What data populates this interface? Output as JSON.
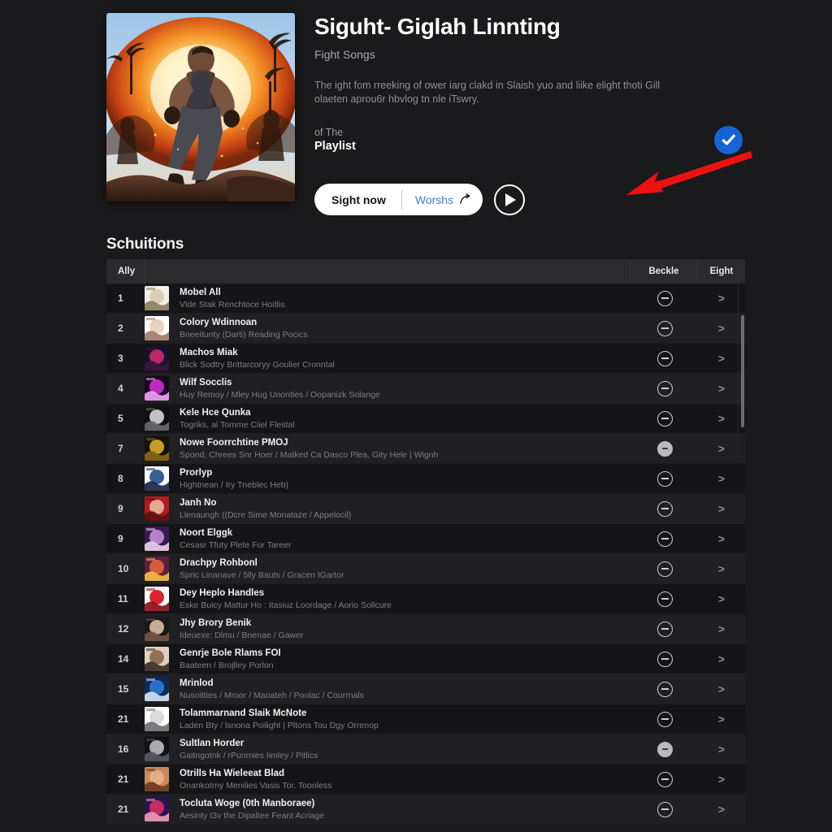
{
  "hero": {
    "title": "Siguht- Giglah Linnting",
    "subtitle": "Fight Songs",
    "description": "The ight fom rreeking of ower iarg clakd in Slaish yuo and liike elight thoti Gill olaeten aprou6r hbvlog tn nle iTswry.",
    "owner_label": "of The",
    "owner_name": "Playlist",
    "verified_icon": "verified-check-icon",
    "cover_icon": "playlist-cover-art"
  },
  "actions": {
    "primary_label": "Sight now",
    "secondary_label": "Worshs",
    "share_icon": "share-arrow-icon",
    "play_icon": "play-icon"
  },
  "annotation": {
    "arrow_icon": "red-pointer-arrow",
    "arrow_color": "#ee1111"
  },
  "section": {
    "title": "Schuitions"
  },
  "table": {
    "headers": {
      "rank": "Ally",
      "middle": "",
      "action": "Beckle",
      "detail": "Eight"
    },
    "chevron": ">",
    "rows": [
      {
        "rank": "1",
        "name": "Mobel All",
        "sub": "Vlde Stak  Renchtoce Hoitlis",
        "action_icon": "remove-circle-icon",
        "action_state": "outline",
        "art": [
          "#f3efe6",
          "#d8cdb6",
          "#8a7b5e"
        ]
      },
      {
        "rank": "2",
        "name": "Colory Wdinnoan",
        "sub": "Bneeitunty (Darti) Reading Pocics",
        "action_icon": "remove-circle-icon",
        "action_state": "outline",
        "art": [
          "#ffffff",
          "#e8cdbb",
          "#9d7b63"
        ]
      },
      {
        "rank": "3",
        "name": "Machos Miak",
        "sub": "Blick Sodtry Brittarcoryy Goulier Cronntal",
        "action_icon": "remove-circle-icon",
        "action_state": "outline",
        "art": [
          "#16122a",
          "#c42a6e",
          "#3b1640"
        ]
      },
      {
        "rank": "4",
        "name": "Wilf Socclis",
        "sub": "Huy Remoy / Mley Hug Unontles / Oopanizk Solange",
        "action_icon": "remove-circle-icon",
        "action_state": "outline",
        "art": [
          "#1a0520",
          "#d22ad0",
          "#f0a8f5"
        ]
      },
      {
        "rank": "5",
        "name": "Kele Hce Qunka",
        "sub": "Togriks, al Tomme Ciiel Flestal",
        "action_icon": "remove-circle-icon",
        "action_state": "outline",
        "art": [
          "#101014",
          "#cfcfd4",
          "#6a6a72"
        ]
      },
      {
        "rank": "7",
        "name": "Nowe Foorrchtine PMOJ",
        "sub": "Spond, Chrees Snr Hoer / Matked Ca Dasco Plea, Gity Hele | Wignh",
        "action_icon": "remove-circle-filled-icon",
        "action_state": "filled",
        "art": [
          "#171206",
          "#d4a92a",
          "#8a6a12"
        ]
      },
      {
        "rank": "8",
        "name": "Prorlyp",
        "sub": "Hightnean / Iry Tneblec Heb)",
        "action_icon": "remove-circle-icon",
        "action_state": "outline",
        "art": [
          "#ffffff",
          "#2a4f8e",
          "#14233f"
        ]
      },
      {
        "rank": "9",
        "name": "Janh No",
        "sub": "Llenaungh  ((Dcre Sime Monataze / Appelocil)",
        "action_icon": "remove-circle-icon",
        "action_state": "outline",
        "art": [
          "#b41a20",
          "#e8b59a",
          "#5e1014"
        ]
      },
      {
        "rank": "9",
        "name": "Noort Elggk",
        "sub": "Cesasr Tfuty Plete For Tareer",
        "action_icon": "remove-circle-icon",
        "action_state": "outline",
        "art": [
          "#3a1a52",
          "#c289d8",
          "#efd3ea"
        ]
      },
      {
        "rank": "10",
        "name": "Drachpy Rohbonl",
        "sub": "Spric Linanave / 5lly Bauts / Gracen IGartor",
        "action_icon": "remove-circle-icon",
        "action_state": "outline",
        "art": [
          "#5e2040",
          "#e0633c",
          "#f2c244"
        ]
      },
      {
        "rank": "11",
        "name": "Dey Heplo Handles",
        "sub": "Eske Buicy Mattur Ho : Itasiuz Loordage / Aorio Sollcure",
        "action_icon": "remove-circle-icon",
        "action_state": "outline",
        "art": [
          "#ffffff",
          "#d8121c",
          "#8a0a12"
        ]
      },
      {
        "rank": "12",
        "name": "Jhy Brory Benik",
        "sub": "Ideuexe: Dlmu / Bnenae / Gawer",
        "action_icon": "remove-circle-icon",
        "action_state": "outline",
        "art": [
          "#18181a",
          "#d8b9a0",
          "#76584a"
        ]
      },
      {
        "rank": "14",
        "name": "Genrje Bole Rlams FOI",
        "sub": "Baateen / Brojlley Porlon",
        "action_icon": "remove-circle-icon",
        "action_state": "outline",
        "art": [
          "#e2cfc0",
          "#8a6a52",
          "#3a2a22"
        ]
      },
      {
        "rank": "15",
        "name": "Mrinlod",
        "sub": "Nusoitties / Mroor / Maoateh / Poolac / Courrnals",
        "action_icon": "remove-circle-icon",
        "action_state": "outline",
        "art": [
          "#0e2a52",
          "#2a7ad4",
          "#d8e6f5"
        ]
      },
      {
        "rank": "21",
        "name": "Tolammarnand Slaik McNote",
        "sub": "Laden Bty / lsnona Poilight | Pltons Tou Dgy Orrenop",
        "action_icon": "remove-circle-icon",
        "action_state": "outline",
        "art": [
          "#ffffff",
          "#d8d8da",
          "#6a6a70"
        ]
      },
      {
        "rank": "16",
        "name": "Sultlan Horder",
        "sub": "Gaitngotnk / rPunmies Iimley / Pitlics",
        "action_icon": "remove-circle-filled-icon",
        "action_state": "filled",
        "art": [
          "#101012",
          "#b8b8bc",
          "#5a5a60"
        ]
      },
      {
        "rank": "21",
        "name": "Otrills Ha Wieleeat Blad",
        "sub": "Onankotrny Menilies Vasis Tor. Toooless",
        "action_icon": "remove-circle-icon",
        "action_state": "outline",
        "art": [
          "#c98a5e",
          "#e8b08a",
          "#6a3a24"
        ]
      },
      {
        "rank": "21",
        "name": "Tocluta Woge (0th Manboraee)",
        "sub": "Aesinty t3v the Dipaltee Feant Acriage",
        "action_icon": "remove-circle-icon",
        "action_state": "outline",
        "art": [
          "#2a1450",
          "#d0306a",
          "#f0a0b8"
        ]
      }
    ]
  }
}
